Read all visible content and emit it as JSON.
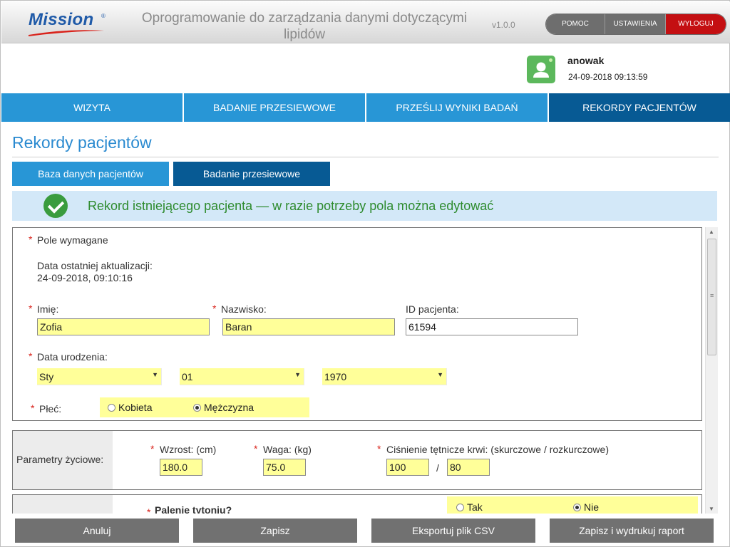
{
  "header": {
    "logo_text": "Mission",
    "logo_reg": "®",
    "app_title": "Oprogramowanie do zarządzania danymi dotyczącymi lipidów",
    "version": "v1.0.0",
    "buttons": {
      "help": "POMOC",
      "settings": "USTAWIENIA",
      "logout": "WYLOGUJ"
    }
  },
  "user": {
    "name": "anowak",
    "datetime": "24-09-2018 09:13:59"
  },
  "nav": {
    "tabs": [
      "WIZYTA",
      "BADANIE PRZESIEWOWE",
      "PRZEŚLIJ WYNIKI BADAŃ",
      "REKORDY PACJENTÓW"
    ],
    "active": 3
  },
  "page": {
    "title": "Rekordy pacjentów",
    "subtabs": [
      "Baza danych pacjentów",
      "Badanie przesiewowe"
    ],
    "banner": "Rekord istniejącego pacjenta — w razie potrzeby pola można edytować"
  },
  "form": {
    "required_note": "Pole wymagane",
    "required_mark": "*",
    "last_update_label": "Data ostatniej aktualizacji:",
    "last_update_value": "24-09-2018, 09:10:16",
    "first_name_label": "Imię:",
    "first_name_value": "Zofia",
    "last_name_label": "Nazwisko:",
    "last_name_value": "Baran",
    "patient_id_label": "ID pacjenta:",
    "patient_id_value": "61594",
    "dob_label": "Data urodzenia:",
    "dob_month": "Sty",
    "dob_day": "01",
    "dob_year": "1970",
    "sex_label": "Płeć:",
    "sex_options": [
      "Kobieta",
      "Mężczyzna"
    ],
    "sex_selected": "Mężczyzna",
    "vitals_label": "Parametry życiowe:",
    "height_label": "Wzrost: (cm)",
    "height_value": "180.0",
    "weight_label": "Waga: (kg)",
    "weight_value": "75.0",
    "bp_label": "Ciśnienie tętnicze krwi: (skurczowe / rozkurczowe)",
    "bp_systolic": "100",
    "bp_separator": "/",
    "bp_diastolic": "80",
    "smoking_label": "Palenie tytoniu?",
    "smoking_options": [
      "Tak",
      "Nie"
    ],
    "smoking_selected": "Nie"
  },
  "footer": {
    "cancel": "Anuluj",
    "save": "Zapisz",
    "export": "Eksportuj plik CSV",
    "save_print": "Zapisz i wydrukuj raport"
  }
}
